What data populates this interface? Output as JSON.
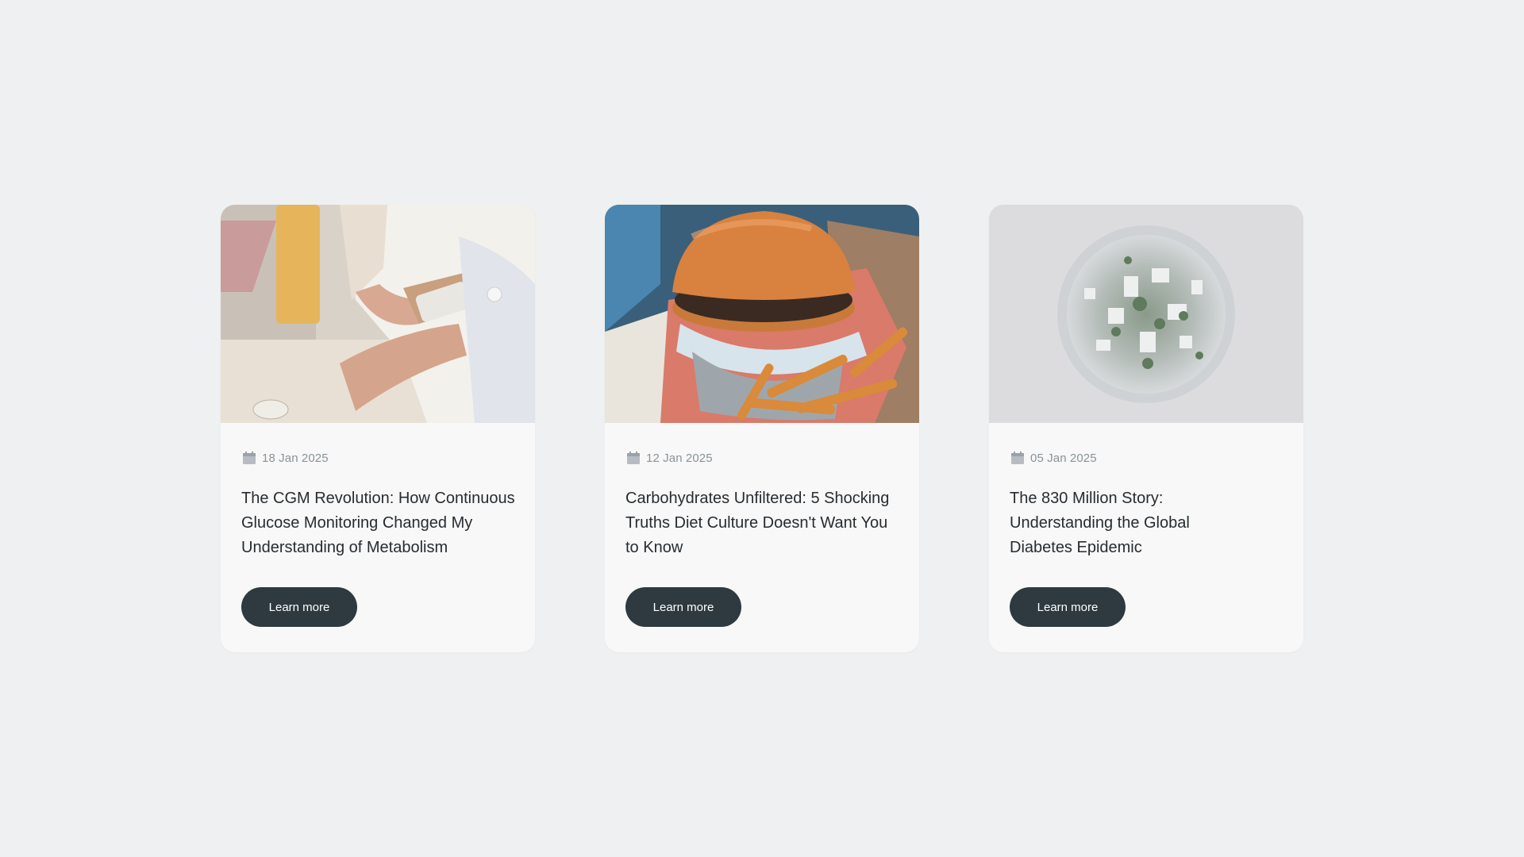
{
  "cards": [
    {
      "date": "18 Jan 2025",
      "title": "The CGM Revolution: How Continuous Glucose Monitoring Changed My Understanding of Metabolism",
      "button_label": "Learn more",
      "image_icon": "person-phone-cgm-photo"
    },
    {
      "date": "12 Jan 2025",
      "title": "Carbohydrates Unfiltered: 5 Shocking Truths Diet Culture Doesn't Want You to Know",
      "button_label": "Learn more",
      "image_icon": "burger-fries-photo"
    },
    {
      "date": "05 Jan 2025",
      "title": "The 830 Million Story: Understanding the Global Diabetes Epidemic",
      "button_label": "Learn more",
      "image_icon": "tiny-planet-city-photo"
    }
  ],
  "colors": {
    "page_background": "#eff0f1",
    "card_background": "#f8f8f8",
    "button_background": "#2e3a3f",
    "date_text": "#8a9399",
    "title_text": "#272c30"
  }
}
